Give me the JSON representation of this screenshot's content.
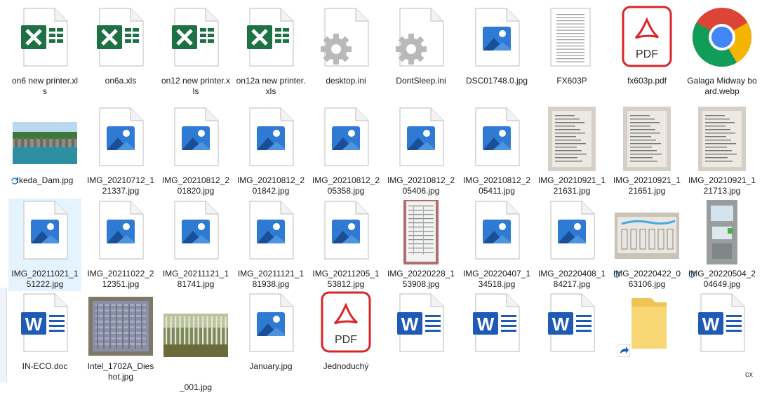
{
  "window": {
    "view": "large-icons"
  },
  "colors": {
    "excel": "#1e7145",
    "word": "#1f5bb5",
    "pdf": "#d9242a",
    "photo": "#2f7bd4",
    "folder": "#f0c355",
    "selection": "#e5f3ff"
  },
  "rows": [
    {
      "items": [
        {
          "name": "on6 new printer.xls",
          "icon": "excel-icon"
        },
        {
          "name": "on6a.xls",
          "icon": "excel-icon"
        },
        {
          "name": "on12 new printer.xls",
          "icon": "excel-icon"
        },
        {
          "name": "on12a new printer.xls",
          "icon": "excel-icon"
        },
        {
          "name": "desktop.ini",
          "icon": "settings-file-icon"
        },
        {
          "name": "DontSleep.ini",
          "icon": "settings-file-icon"
        },
        {
          "name": "DSC01748.0.jpg",
          "icon": "photo-file-icon"
        },
        {
          "name": "FX603P",
          "icon": "text-file-icon"
        },
        {
          "name": "fx603p.pdf",
          "icon": "pdf-icon"
        },
        {
          "name": "Galaga Midway board.webp",
          "icon": "chrome-icon"
        }
      ]
    },
    {
      "items": [
        {
          "name": "Ikeda_Dam.jpg",
          "icon": "dam-photo-thumbnail",
          "sync": true
        },
        {
          "name": "IMG_20210712_121337.jpg",
          "icon": "photo-file-icon"
        },
        {
          "name": "IMG_20210812_201820.jpg",
          "icon": "photo-file-icon"
        },
        {
          "name": "IMG_20210812_201842.jpg",
          "icon": "photo-file-icon"
        },
        {
          "name": "IMG_20210812_205358.jpg",
          "icon": "photo-file-icon"
        },
        {
          "name": "IMG_20210812_205406.jpg",
          "icon": "photo-file-icon"
        },
        {
          "name": "IMG_20210812_205411.jpg",
          "icon": "photo-file-icon"
        },
        {
          "name": "IMG_20210921_121631.jpg",
          "icon": "document-photo-thumbnail"
        },
        {
          "name": "IMG_20210921_121651.jpg",
          "icon": "document-photo-thumbnail"
        },
        {
          "name": "IMG_20210921_121713.jpg",
          "icon": "document-photo-thumbnail"
        }
      ]
    },
    {
      "items": [
        {
          "name": "IMG_20211021_151222.jpg",
          "icon": "photo-file-icon",
          "selected": true
        },
        {
          "name": "IMG_20211022_212351.jpg",
          "icon": "photo-file-icon"
        },
        {
          "name": "IMG_20211121_181741.jpg",
          "icon": "photo-file-icon"
        },
        {
          "name": "IMG_20211121_181938.jpg",
          "icon": "photo-file-icon"
        },
        {
          "name": "IMG_20211205_153812.jpg",
          "icon": "photo-file-icon"
        },
        {
          "name": "IMG_20220228_153908.jpg",
          "icon": "table-photo-thumbnail"
        },
        {
          "name": "IMG_20220407_134518.jpg",
          "icon": "photo-file-icon"
        },
        {
          "name": "IMG_20220408_184217.jpg",
          "icon": "photo-file-icon"
        },
        {
          "name": "IMG_20220422_063106.jpg",
          "icon": "whiteboard-photo-thumbnail",
          "sync": true
        },
        {
          "name": "IMG_20220504_204649.jpg",
          "icon": "machine-photo-thumbnail",
          "sync": true
        }
      ]
    },
    {
      "items": [
        {
          "name": "IN-ECO.doc",
          "icon": "word-icon"
        },
        {
          "name": "Intel_1702A_Dieshot.jpg",
          "icon": "chip-photo-thumbnail"
        },
        {
          "name": "_001.jpg",
          "icon": "forest-photo-thumbnail",
          "labelOffset": true
        },
        {
          "name": "January.jpg",
          "icon": "photo-file-icon"
        },
        {
          "name": "Jednoduchý",
          "icon": "pdf-icon"
        },
        {
          "name": "",
          "icon": "word-icon"
        },
        {
          "name": "",
          "icon": "word-icon"
        },
        {
          "name": "",
          "icon": "word-icon"
        },
        {
          "name": "",
          "icon": "folder-shortcut-icon"
        },
        {
          "name": "",
          "icon": "word-icon"
        }
      ]
    }
  ],
  "edge_text": {
    "right_cx": "cx"
  }
}
